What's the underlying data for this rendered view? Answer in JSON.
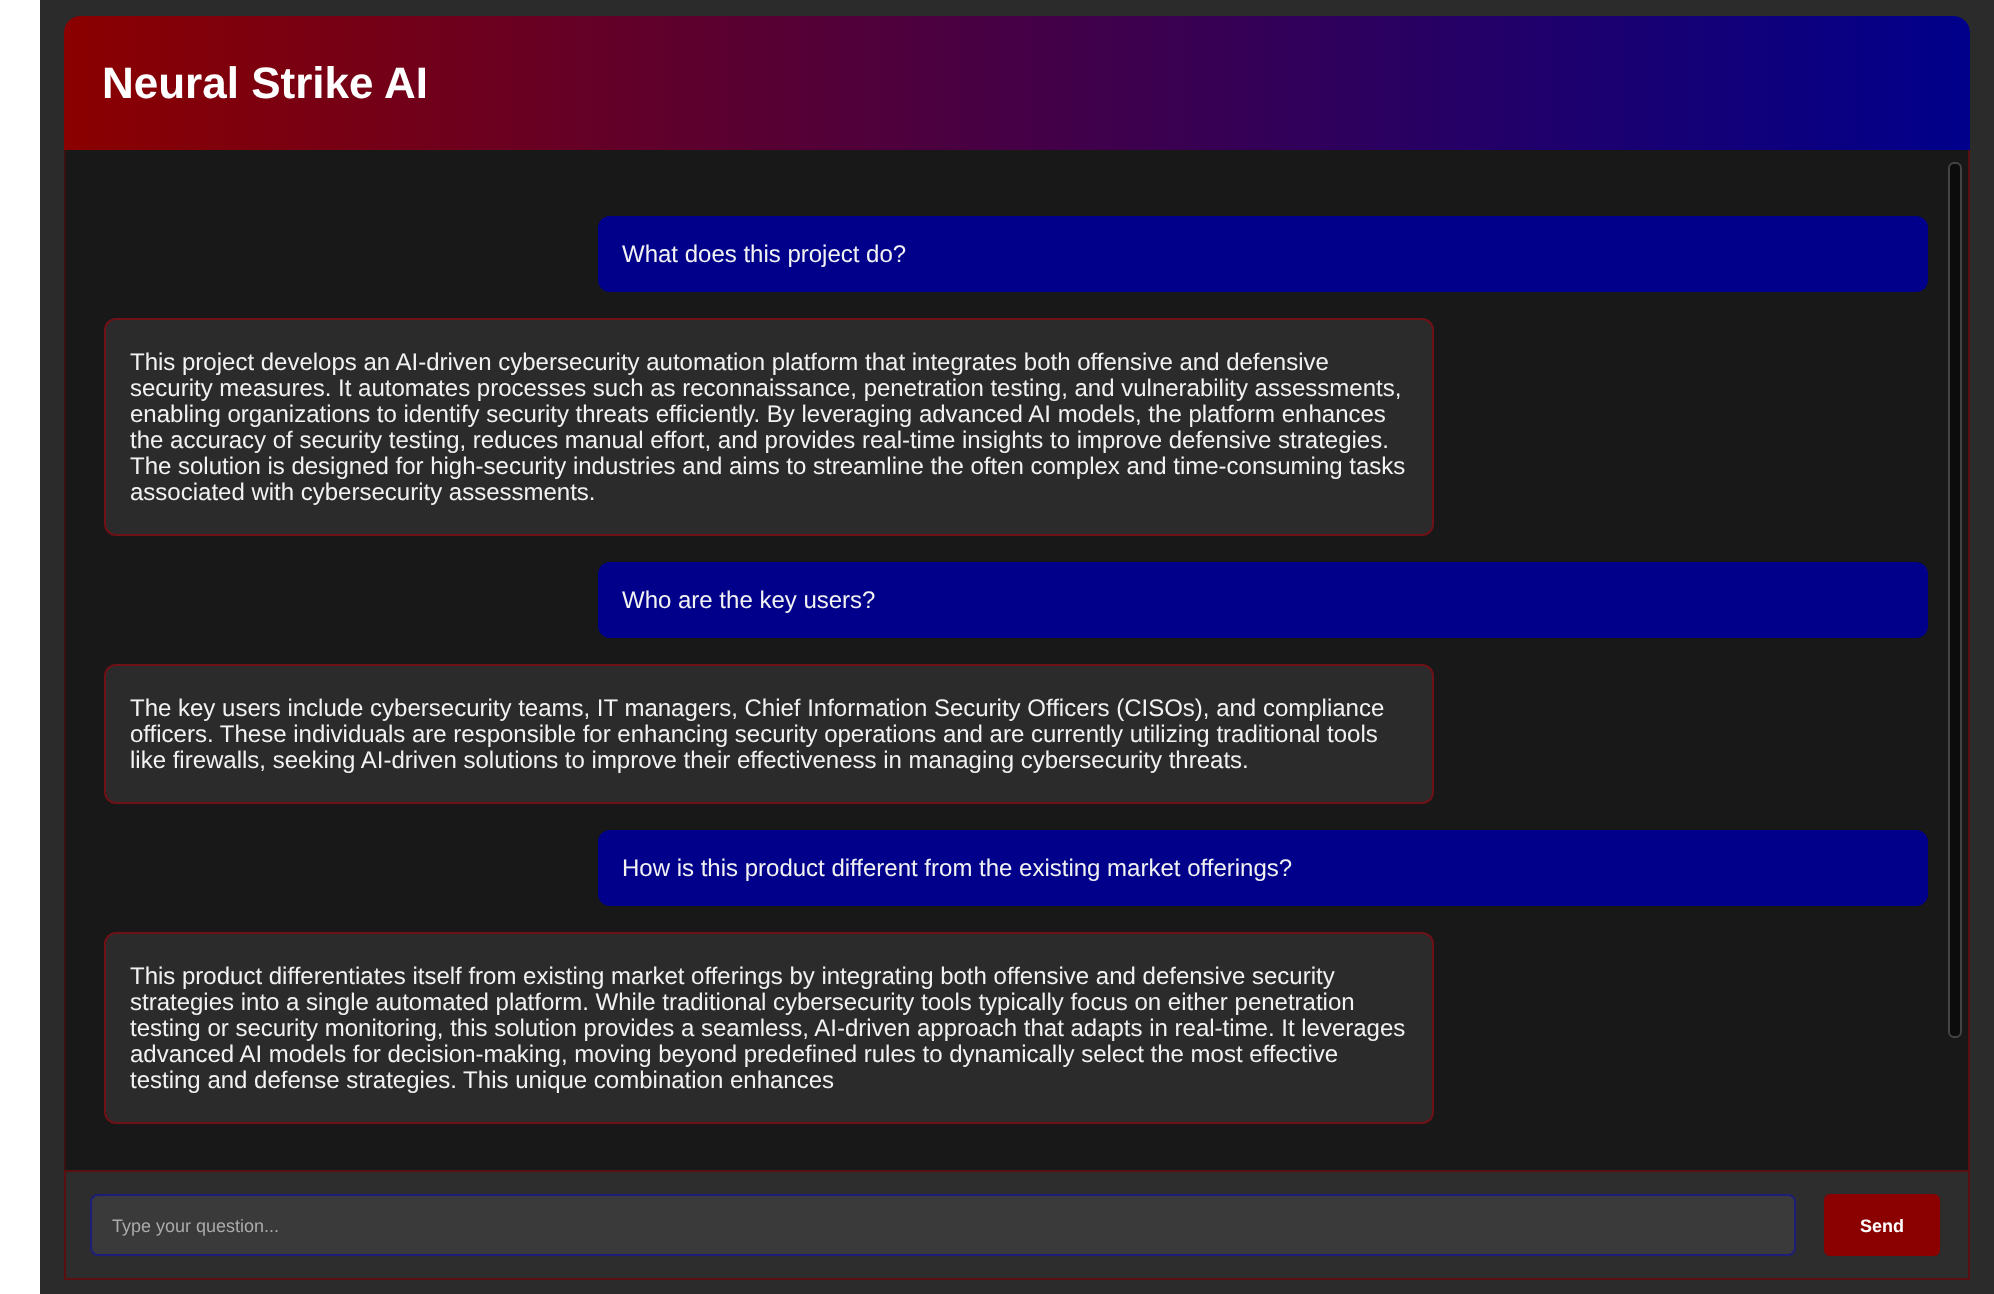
{
  "header": {
    "title": "Neural Strike AI"
  },
  "messages": [
    {
      "kind": "user",
      "text": "What does this project do?"
    },
    {
      "kind": "bot",
      "text": "This project develops an AI-driven cybersecurity automation platform that integrates both offensive and defensive security measures. It automates processes such as reconnaissance, penetration testing, and vulnerability assessments, enabling organizations to identify security threats efficiently. By leveraging advanced AI models, the platform enhances the accuracy of security testing, reduces manual effort, and provides real-time insights to improve defensive strategies. The solution is designed for high-security industries and aims to streamline the often complex and time-consuming tasks associated with cybersecurity assessments."
    },
    {
      "kind": "user",
      "text": "Who are the key users?"
    },
    {
      "kind": "bot",
      "text": "The key users include cybersecurity teams, IT managers, Chief Information Security Officers (CISOs), and compliance officers. These individuals are responsible for enhancing security operations and are currently utilizing traditional tools like firewalls, seeking AI-driven solutions to improve their effectiveness in managing cybersecurity threats."
    },
    {
      "kind": "user",
      "text": "How is this product different from the existing market offerings?"
    },
    {
      "kind": "bot",
      "text": "This product differentiates itself from existing market offerings by integrating both offensive and defensive security strategies into a single automated platform. While traditional cybersecurity tools typically focus on either penetration testing or security monitoring, this solution provides a seamless, AI-driven approach that adapts in real-time. It leverages advanced AI models for decision-making, moving beyond predefined rules to dynamically select the most effective testing and defense strategies. This unique combination enhances"
    }
  ],
  "composer": {
    "placeholder": "Type your question...",
    "button": "Send"
  }
}
